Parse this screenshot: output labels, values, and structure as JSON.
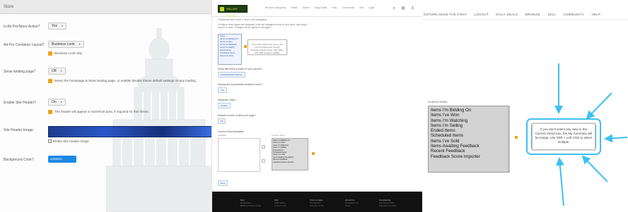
{
  "panel1": {
    "header": "Store",
    "rows": [
      {
        "label": "Is Ad Pro/Store Active?",
        "value": "Yes"
      },
      {
        "label": "Ad Pro Container Layout?",
        "value": "Business Look",
        "note": "Business Look only."
      },
      {
        "label": "Show landing page?",
        "value": "Off",
        "note": "Select the homepage & Store landing page, or enable/ disable theme default settings on any loading."
      },
      {
        "label": "Enable Site Header?",
        "value": "On",
        "note": "The header will appear in Storefront area, if required for this theme."
      },
      {
        "label": "Site Header Image:"
      },
      {
        "label": "Background Color?",
        "value": "#1E88E5"
      }
    ],
    "checkbox_label": "Delete Site header image",
    "icons": {
      "dropdown": "chevron-down-icon",
      "warning": "warning-icon",
      "watermark": "capitol-building-icon"
    }
  },
  "panel2": {
    "logo_text": "SELLER TOOLS",
    "nav_links": [
      "Browse Categories",
      "Deals",
      "Stores",
      "Daily Deals",
      "Help",
      "Community",
      "Sell",
      "Login"
    ],
    "crumb": "Customize your store > Store Left Navigation",
    "intro": "Configure which pages are displayed in the left navigation menu of your store. Use drag & drop to re-order. Changes will be applied to all pages.",
    "small_list": [
      "Home",
      "Items I'm Bidding On",
      "Items I'm Won",
      "Items I'm Watching",
      "Items I'm Selling",
      "Ended Items",
      "Scheduled Items",
      "Items I've Sold"
    ],
    "tip_text": "If you don't select any view in the Current Views box, the My Summary will be empty. Use Shift + Left Click to select multiple.",
    "fields": [
      {
        "label": "Show title block in place of your banner?",
        "button": "Enable/Disable Banner"
      },
      {
        "label": "Display the dynamically rendered menu?",
        "button": "Yes"
      },
      {
        "label": "Separator Style?",
        "button": "Default"
      },
      {
        "label": "Default number of items per page?",
        "button": "25"
      }
    ],
    "views_label": "Current Views/Available",
    "available_label": "Available",
    "current_label": "Current Views",
    "big_list_short": [
      "Items I'm Bidding On",
      "Items I've Won",
      "Items I'm Watching",
      "Items I'm Selling",
      "Ended Items",
      "Scheduled Items",
      "Items I've Sold",
      "Items Awaiting Feedback",
      "Recent Feedback",
      "Feedback Score Importer"
    ],
    "go_label": "Save",
    "footer": [
      {
        "title": "Buy",
        "items": [
          "Registration",
          "Bidding & buying help"
        ]
      },
      {
        "title": "Sell",
        "items": [
          "Start selling",
          "Learn to sell"
        ]
      },
      {
        "title": "Tools & Apps",
        "items": [
          "Developers",
          "Security center"
        ]
      },
      {
        "title": "About Us",
        "items": [
          "Company info",
          "News"
        ]
      },
      {
        "title": "Community",
        "items": [
          "Announcements",
          "Discussion boards"
        ]
      }
    ],
    "icons": {
      "search": "search-icon",
      "cart": "cart-icon",
      "user": "user-icon",
      "warning": "warning-icon"
    }
  },
  "panel3": {
    "menu": [
      "ESTORE MADE THE FIRST",
      "LOGOUT",
      "DAILY DEALS",
      "BROWSE",
      "SELL",
      "COMMUNITY",
      "HELP"
    ],
    "current_views_label": "Current views",
    "list": [
      "Items I'm Bidding On",
      "Items I've Won",
      "Items I'm Watching",
      "Items I'm Selling",
      "Ended Items",
      "Scheduled Items",
      "Items I've Sold",
      "Items Awaiting Feedback",
      "Recent Feedback",
      "Feedback Score Importer"
    ],
    "tooltip": "If you don't select any view in the Current Views box, the My Summary will be empty. Use Shift + Left Click to select multiple.",
    "arrow_color": "#3EC1F0",
    "highlight_color": "#3EC1F0",
    "warning_color": "#F0A30A"
  }
}
